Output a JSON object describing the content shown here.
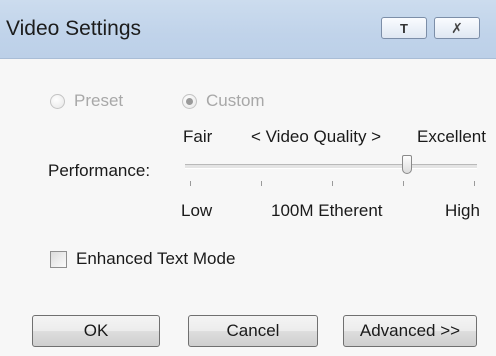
{
  "window": {
    "title": "Video Settings",
    "minimize_glyph": "T",
    "close_glyph": "✗"
  },
  "mode": {
    "preset_label": "Preset",
    "custom_label": "Custom",
    "selected": "custom",
    "enabled": false
  },
  "slider": {
    "label": "Performance:",
    "top_left_label": "Fair",
    "top_center_label": "< Video Quality >",
    "top_right_label": "Excellent",
    "bottom_left_label": "Low",
    "bottom_center_label": "100M Etherent",
    "bottom_right_label": "High",
    "tick_count": 5,
    "value_fraction": 0.75
  },
  "enhanced_text_mode": {
    "label": "Enhanced Text Mode",
    "checked": false
  },
  "buttons": {
    "ok_label": "OK",
    "cancel_label": "Cancel",
    "advanced_label": "Advanced >>"
  },
  "colors": {
    "titlebar": "#c0d3ea",
    "disabled_text": "#a8a8a8"
  },
  "icons": {
    "minimize": "minimize-icon",
    "close": "close-icon"
  }
}
